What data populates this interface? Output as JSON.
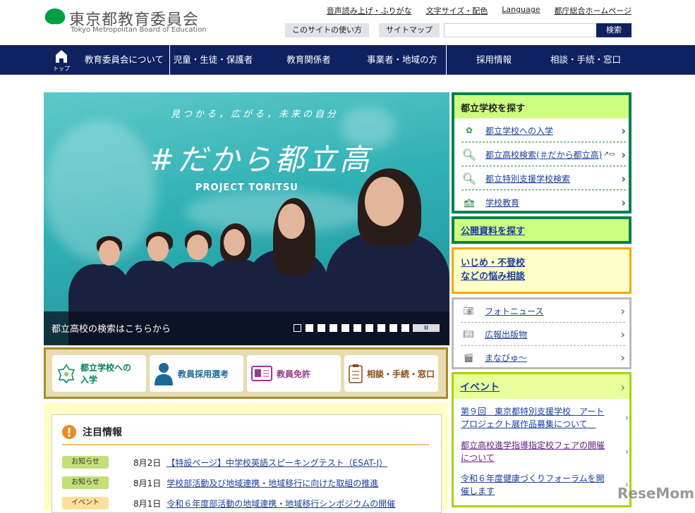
{
  "header": {
    "logo_jp": "東京都教育委員会",
    "logo_en": "Tokyo Metropolitan Board of Education",
    "top_links": [
      "音声読み上げ・ふりがな",
      "文字サイズ・配色",
      "Language",
      "都庁総合ホームページ"
    ],
    "buttons": [
      "このサイトの使い方",
      "サイトマップ"
    ],
    "search_placeholder": "",
    "search_button": "検索"
  },
  "nav": {
    "home": "トップ",
    "items": [
      "教育委員会について",
      "児童・生徒・保護者",
      "教育関係者",
      "事業者・地域の方",
      "採用情報",
      "相談・手続・窓口"
    ]
  },
  "hero": {
    "tagline": "見つかる，広がる，未来の自分",
    "title": "#だから都立高",
    "project": "PROJECT TORITSU",
    "caption": "都立高校の検索はこちらから",
    "slide_count": 11,
    "active_slide": 1,
    "pause_label": "II"
  },
  "quick_links": [
    {
      "label": "都立学校への入学",
      "color": "#00845a"
    },
    {
      "label": "教員採用選考",
      "color": "#1a6a9a"
    },
    {
      "label": "教員免許",
      "color": "#9a3a8a"
    },
    {
      "label": "相談・手続・窓口",
      "color": "#8a4a10"
    }
  ],
  "notice": {
    "title": "注目情報",
    "items": [
      {
        "badge": "お知らせ",
        "badge_color": "#c2e07a",
        "date": "8月2日",
        "text": "【特設ページ】中学校英語スピーキングテスト（ESAT-J）"
      },
      {
        "badge": "お知らせ",
        "badge_color": "#c2e07a",
        "date": "8月1日",
        "text": "学校部活動及び地域連携・地域移行に向けた取組の推進"
      },
      {
        "badge": "イベント",
        "badge_color": "#ffe09a",
        "date": "8月1日",
        "text": "令和６年度部活動の地域連携・地域移行シンポジウムの開催"
      }
    ]
  },
  "sidebar": {
    "schools": {
      "title": "都立学校を探す",
      "items": [
        "都立学校への入学",
        "都立高校検索(＃だから都立高)",
        "都立特別支援学校検索",
        "学校教育"
      ]
    },
    "documents": "公開資料を探す",
    "bullying": [
      "いじめ・不登校",
      "などの悩み相談"
    ],
    "media": [
      "フォトニュース",
      "広報出版物",
      "まなびゅ～"
    ],
    "events": {
      "title": "イベント",
      "items": [
        "第９回　東京都特別支援学校　アートプロジェクト展作品募集について　",
        "都立高校進学指導指定校フェアの開催について",
        "令和６年度健康づくりフォーラムを開催します"
      ]
    }
  },
  "watermark": "ReseMom"
}
